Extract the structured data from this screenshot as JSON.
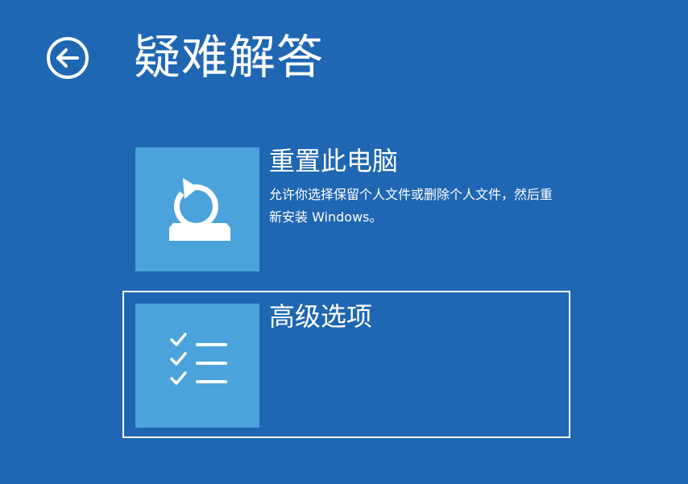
{
  "header": {
    "title": "疑难解答",
    "back_icon": "back-arrow-icon"
  },
  "options": [
    {
      "title": "重置此电脑",
      "description": "允许你选择保留个人文件或删除个人文件，然后重新安装 Windows。",
      "icon": "reset-pc-icon",
      "selected": false
    },
    {
      "title": "高级选项",
      "description": "",
      "icon": "checklist-icon",
      "selected": true
    }
  ],
  "colors": {
    "background": "#1f67b3",
    "tile": "#4ba3db",
    "text": "#ffffff",
    "selection_border": "#ffffff"
  }
}
